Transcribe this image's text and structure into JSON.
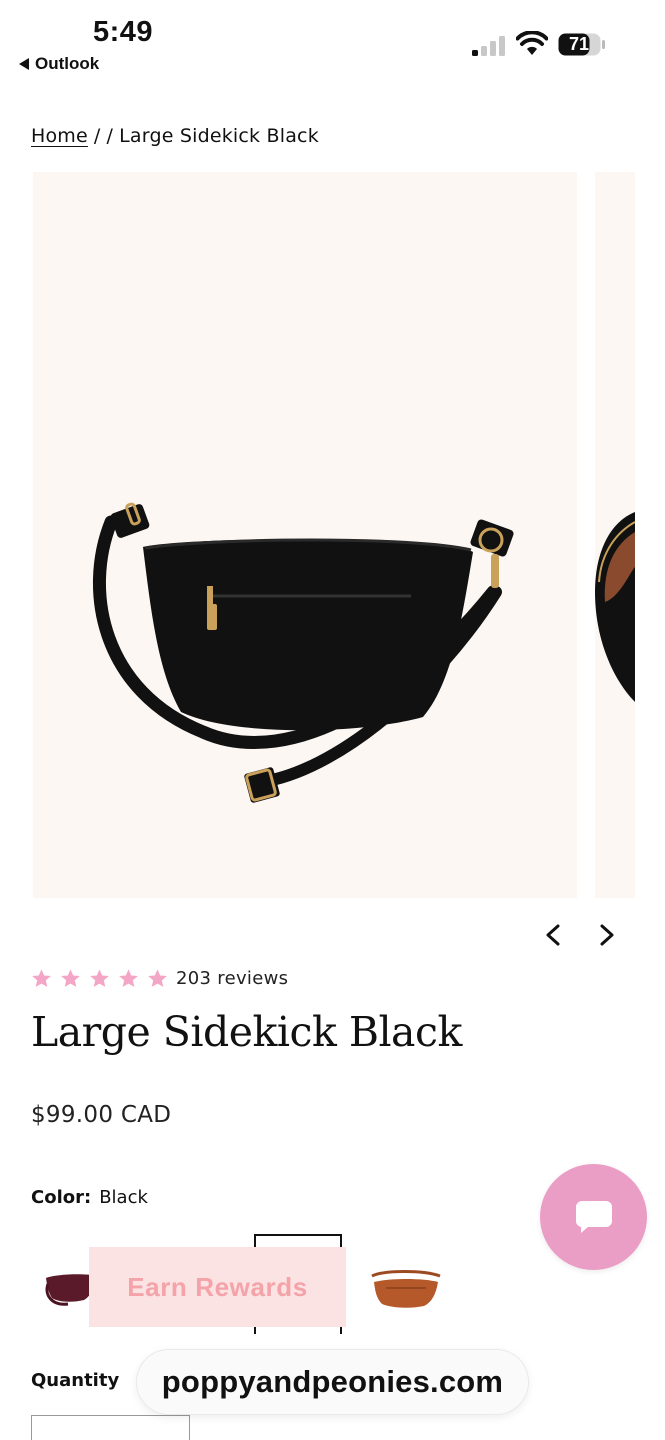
{
  "status_bar": {
    "time": "5:49",
    "back_app": "Outlook",
    "battery_percent": "71",
    "signal_bars_filled": 1,
    "signal_bars_total": 4
  },
  "breadcrumb": {
    "home": "Home",
    "sep1": "/",
    "sep2": "/",
    "current": "Large Sidekick Black"
  },
  "gallery": {
    "prev_icon": "chevron-left-icon",
    "next_icon": "chevron-right-icon"
  },
  "product": {
    "rating": 5,
    "reviews": "203 reviews",
    "title": "Large Sidekick Black",
    "price": "$99.00 CAD",
    "color_label": "Color:",
    "color_value": "Black",
    "quantity_label": "Quantity"
  },
  "overlays": {
    "earn_rewards": "Earn Rewards",
    "url": "poppyandpeonies.com",
    "chat_icon": "chat-bubble-icon"
  },
  "colors": {
    "star_pink": "#f4a6c6",
    "chat_pink": "#ea9ec5",
    "rewards_bg": "#fbe3e4",
    "rewards_text": "#f4a3a9",
    "gallery_bg": "#fcf7f3"
  }
}
